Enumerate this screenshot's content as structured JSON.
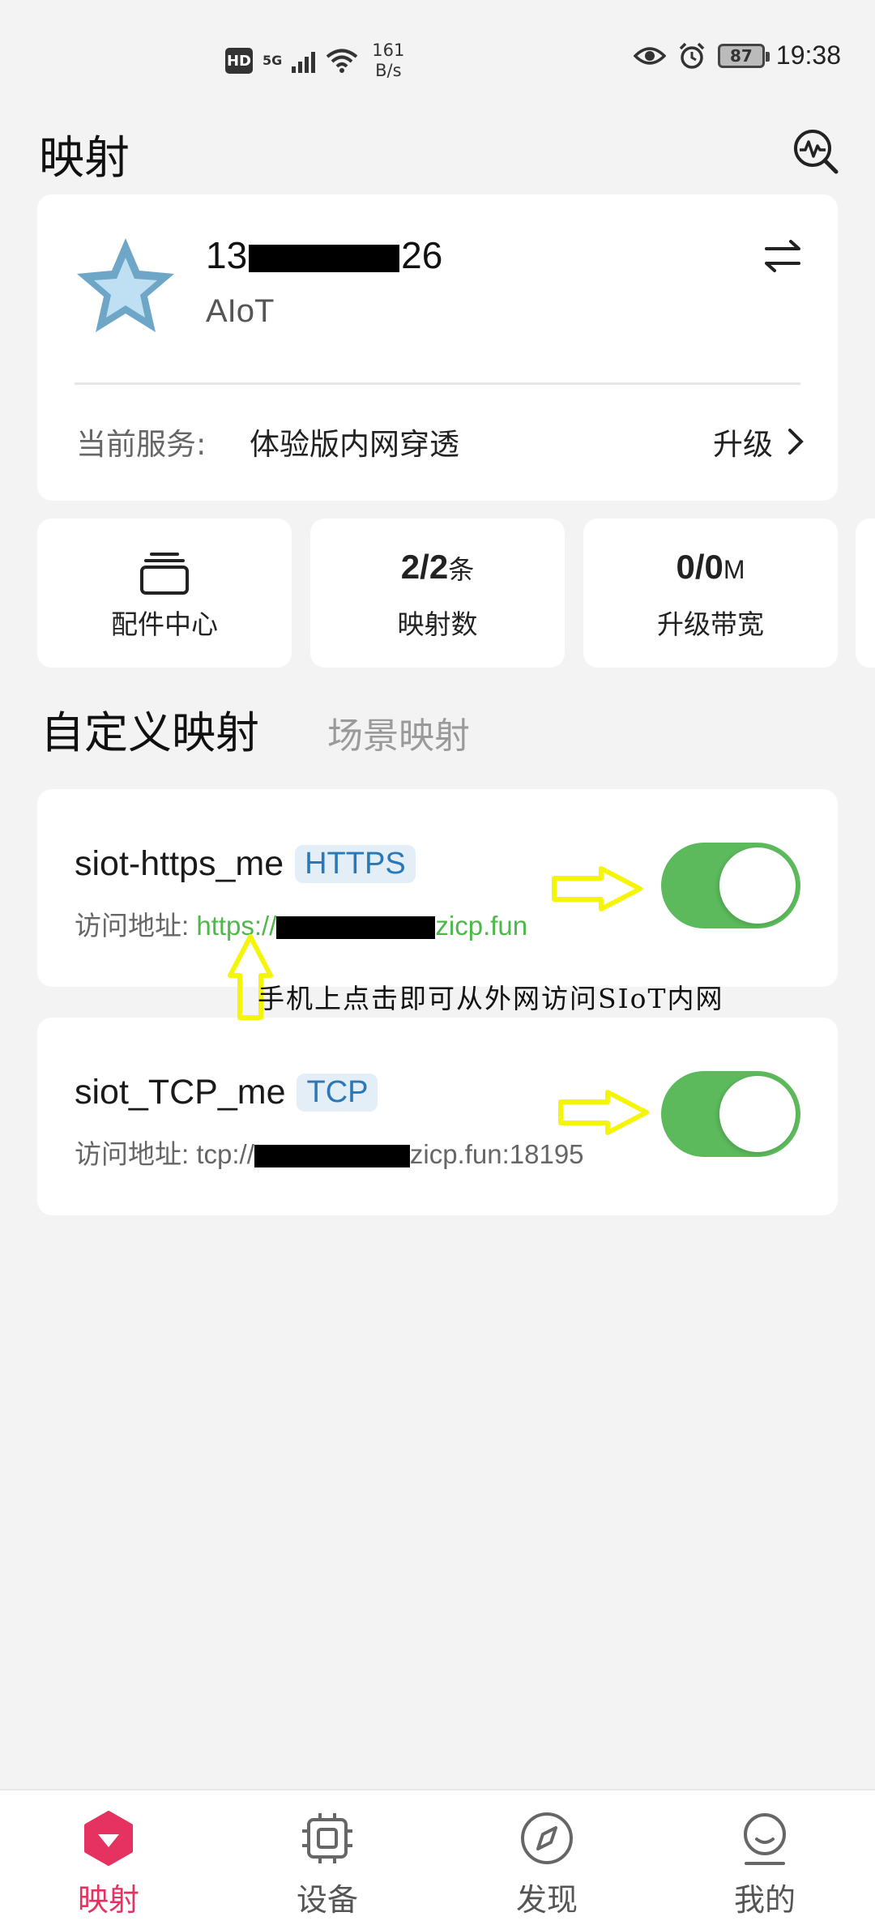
{
  "status_bar": {
    "hd": "HD",
    "network": "5G",
    "speed_value": "161",
    "speed_unit": "B/s",
    "battery": "87",
    "time": "19:38"
  },
  "header": {
    "title": "映射"
  },
  "account": {
    "id_prefix": "13",
    "id_suffix": "26",
    "org": "AIoT",
    "service_label": "当前服务:",
    "service_value": "体验版内网穿透",
    "upgrade_label": "升级"
  },
  "stats": [
    {
      "label": "配件中心"
    },
    {
      "value": "2/2",
      "unit": "条",
      "label": "映射数"
    },
    {
      "value": "0/0",
      "unit": "M",
      "label": "升级带宽"
    }
  ],
  "tabs": {
    "active": "自定义映射",
    "inactive": "场景映射"
  },
  "mappings": [
    {
      "name": "siot-https_me",
      "protocol": "HTTPS",
      "addr_label": "访问地址:",
      "addr_prefix": "https://",
      "addr_suffix": "zicp.fun",
      "enabled": true
    },
    {
      "name": "siot_TCP_me",
      "protocol": "TCP",
      "addr_label": "访问地址:",
      "addr_prefix": "tcp://",
      "addr_suffix": "zicp.fun:18195",
      "enabled": true
    }
  ],
  "annotation": {
    "text": "手机上点击即可从外网访问SIoT内网"
  },
  "bottom_nav": [
    {
      "label": "映射",
      "active": true
    },
    {
      "label": "设备",
      "active": false
    },
    {
      "label": "发现",
      "active": false
    },
    {
      "label": "我的",
      "active": false
    }
  ],
  "colors": {
    "accent": "#e53260",
    "toggle_on": "#5cba5c",
    "link_green": "#4fb84a",
    "badge_blue": "#2b78b8",
    "annotation_yellow": "#f5f50a"
  }
}
